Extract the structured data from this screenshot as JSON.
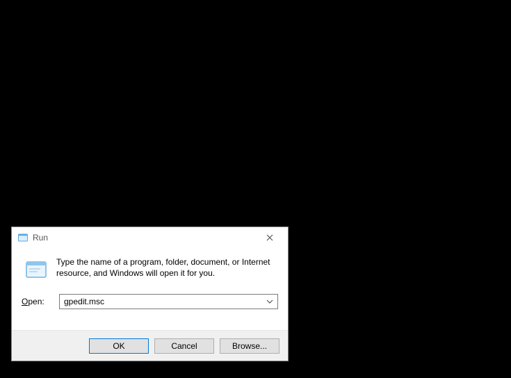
{
  "dialog": {
    "title": "Run",
    "description": "Type the name of a program, folder, document, or Internet resource, and Windows will open it for you.",
    "open_label_pre": "O",
    "open_label_post": "pen:",
    "input_value": "gpedit.msc",
    "buttons": {
      "ok": "OK",
      "cancel": "Cancel",
      "browse": "Browse..."
    }
  }
}
